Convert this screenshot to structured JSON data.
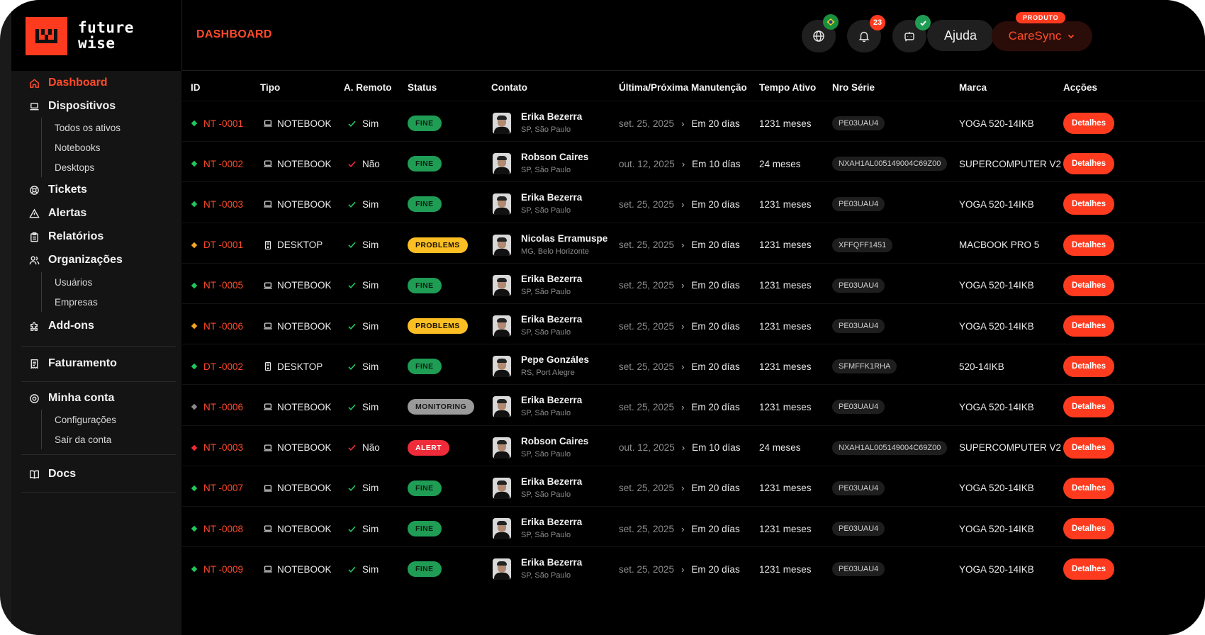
{
  "app": {
    "logo_line1": "future",
    "logo_line2": "wise"
  },
  "header": {
    "title": "DASHBOARD",
    "notifications_count": "23",
    "help_label": "Ajuda",
    "product_tag": "PRODUTO",
    "product_label": "CareSync"
  },
  "sidebar": {
    "dashboard": "Dashboard",
    "dispositivos": "Dispositivos",
    "dispositivos_sub": [
      "Todos os ativos",
      "Notebooks",
      "Desktops"
    ],
    "tickets": "Tickets",
    "alertas": "Alertas",
    "relatorios": "Relatórios",
    "organizacoes": "Organizações",
    "organizacoes_sub": [
      "Usuários",
      "Empresas"
    ],
    "addons": "Add-ons",
    "faturamento": "Faturamento",
    "minha_conta": "Minha conta",
    "minha_conta_sub": [
      "Configurações",
      "Saír da conta"
    ],
    "docs": "Docs"
  },
  "table": {
    "headers": [
      "ID",
      "Tipo",
      "A. Remoto",
      "Status",
      "Contato",
      "Última/Próxima Manutenção",
      "Tempo Ativo",
      "Nro Série",
      "Marca",
      "Acções"
    ],
    "rows": [
      {
        "dot": "#22c55e",
        "id": "NT -0001",
        "tipo": "NOTEBOOK",
        "tipo_icon": "laptop",
        "remoto": "Sim",
        "remoto_ok": true,
        "status": "FINE",
        "name": "Erika Bezerra",
        "loc": "SP, São Paulo",
        "last": "set. 25, 2025",
        "next": "Em 20 días",
        "tempo": "1231 meses",
        "serie": "PE03UAU4",
        "marca": "YOGA 520-14IKB",
        "acao": "Detalhes"
      },
      {
        "dot": "#22c55e",
        "id": "NT -0002",
        "tipo": "NOTEBOOK",
        "tipo_icon": "laptop",
        "remoto": "Não",
        "remoto_ok": false,
        "status": "FINE",
        "name": "Robson Caires",
        "loc": "SP, São Paulo",
        "last": "out. 12, 2025",
        "next": "Em 10 días",
        "tempo": "24 meses",
        "serie": "NXAH1AL005149004C69Z00",
        "marca": "SUPERCOMPUTER V2",
        "acao": "Detalhes"
      },
      {
        "dot": "#22c55e",
        "id": "NT -0003",
        "tipo": "NOTEBOOK",
        "tipo_icon": "laptop",
        "remoto": "Sim",
        "remoto_ok": true,
        "status": "FINE",
        "name": "Erika Bezerra",
        "loc": "SP, São Paulo",
        "last": "set. 25, 2025",
        "next": "Em 20 días",
        "tempo": "1231 meses",
        "serie": "PE03UAU4",
        "marca": "YOGA 520-14IKB",
        "acao": "Detalhes"
      },
      {
        "dot": "#f5a524",
        "id": "DT -0001",
        "tipo": "DESKTOP",
        "tipo_icon": "desktop",
        "remoto": "Sim",
        "remoto_ok": true,
        "status": "PROBLEMS",
        "name": "Nicolas Erramuspe",
        "loc": "MG, Belo Horizonte",
        "last": "set. 25, 2025",
        "next": "Em 20 días",
        "tempo": "1231 meses",
        "serie": "XFFQFF1451",
        "marca": "MACBOOK PRO 5",
        "acao": "Detalhes"
      },
      {
        "dot": "#22c55e",
        "id": "NT -0005",
        "tipo": "NOTEBOOK",
        "tipo_icon": "laptop",
        "remoto": "Sim",
        "remoto_ok": true,
        "status": "FINE",
        "name": "Erika Bezerra",
        "loc": "SP, São Paulo",
        "last": "set. 25, 2025",
        "next": "Em 20 días",
        "tempo": "1231 meses",
        "serie": "PE03UAU4",
        "marca": "YOGA 520-14IKB",
        "acao": "Detalhes"
      },
      {
        "dot": "#f5a524",
        "id": "NT -0006",
        "tipo": "NOTEBOOK",
        "tipo_icon": "laptop",
        "remoto": "Sim",
        "remoto_ok": true,
        "status": "PROBLEMS",
        "name": "Erika Bezerra",
        "loc": "SP, São Paulo",
        "last": "set. 25, 2025",
        "next": "Em 20 días",
        "tempo": "1231 meses",
        "serie": "PE03UAU4",
        "marca": "YOGA 520-14IKB",
        "acao": "Detalhes"
      },
      {
        "dot": "#22c55e",
        "id": "DT -0002",
        "tipo": "DESKTOP",
        "tipo_icon": "desktop",
        "remoto": "Sim",
        "remoto_ok": true,
        "status": "FINE",
        "name": "Pepe Gonzáles",
        "loc": "RS, Port Alegre",
        "last": "set. 25, 2025",
        "next": "Em 20 días",
        "tempo": "1231 meses",
        "serie": "SFMFFK1RHA",
        "marca": "520-14IKB",
        "acao": "Detalhes"
      },
      {
        "dot": "#8a8a8a",
        "id": "NT -0006",
        "tipo": "NOTEBOOK",
        "tipo_icon": "laptop",
        "remoto": "Sim",
        "remoto_ok": true,
        "status": "MONITORING",
        "name": "Erika Bezerra",
        "loc": "SP, São Paulo",
        "last": "set. 25, 2025",
        "next": "Em 20 días",
        "tempo": "1231 meses",
        "serie": "PE03UAU4",
        "marca": "YOGA 520-14IKB",
        "acao": "Detalhes"
      },
      {
        "dot": "#ef2b3a",
        "id": "NT -0003",
        "tipo": "NOTEBOOK",
        "tipo_icon": "laptop",
        "remoto": "Não",
        "remoto_ok": false,
        "status": "ALERT",
        "name": "Robson Caires",
        "loc": "SP, São Paulo",
        "last": "out. 12, 2025",
        "next": "Em 10 días",
        "tempo": "24 meses",
        "serie": "NXAH1AL005149004C69Z00",
        "marca": "SUPERCOMPUTER V2",
        "acao": "Detalhes"
      },
      {
        "dot": "#22c55e",
        "id": "NT -0007",
        "tipo": "NOTEBOOK",
        "tipo_icon": "laptop",
        "remoto": "Sim",
        "remoto_ok": true,
        "status": "FINE",
        "name": "Erika Bezerra",
        "loc": "SP, São Paulo",
        "last": "set. 25, 2025",
        "next": "Em 20 días",
        "tempo": "1231 meses",
        "serie": "PE03UAU4",
        "marca": "YOGA 520-14IKB",
        "acao": "Detalhes"
      },
      {
        "dot": "#22c55e",
        "id": "NT -0008",
        "tipo": "NOTEBOOK",
        "tipo_icon": "laptop",
        "remoto": "Sim",
        "remoto_ok": true,
        "status": "FINE",
        "name": "Erika Bezerra",
        "loc": "SP, São Paulo",
        "last": "set. 25, 2025",
        "next": "Em 20 días",
        "tempo": "1231 meses",
        "serie": "PE03UAU4",
        "marca": "YOGA 520-14IKB",
        "acao": "Detalhes"
      },
      {
        "dot": "#22c55e",
        "id": "NT -0009",
        "tipo": "NOTEBOOK",
        "tipo_icon": "laptop",
        "remoto": "Sim",
        "remoto_ok": true,
        "status": "FINE",
        "name": "Erika Bezerra",
        "loc": "SP, São Paulo",
        "last": "set. 25, 2025",
        "next": "Em 20 días",
        "tempo": "1231 meses",
        "serie": "PE03UAU4",
        "marca": "YOGA 520-14IKB",
        "acao": "Detalhes"
      }
    ]
  },
  "colors": {
    "accent": "#ff3b1f",
    "fine": "#1f9d55",
    "problems": "#fbbf24",
    "monitoring": "#9a9a9a",
    "alert": "#ef2b3a"
  }
}
